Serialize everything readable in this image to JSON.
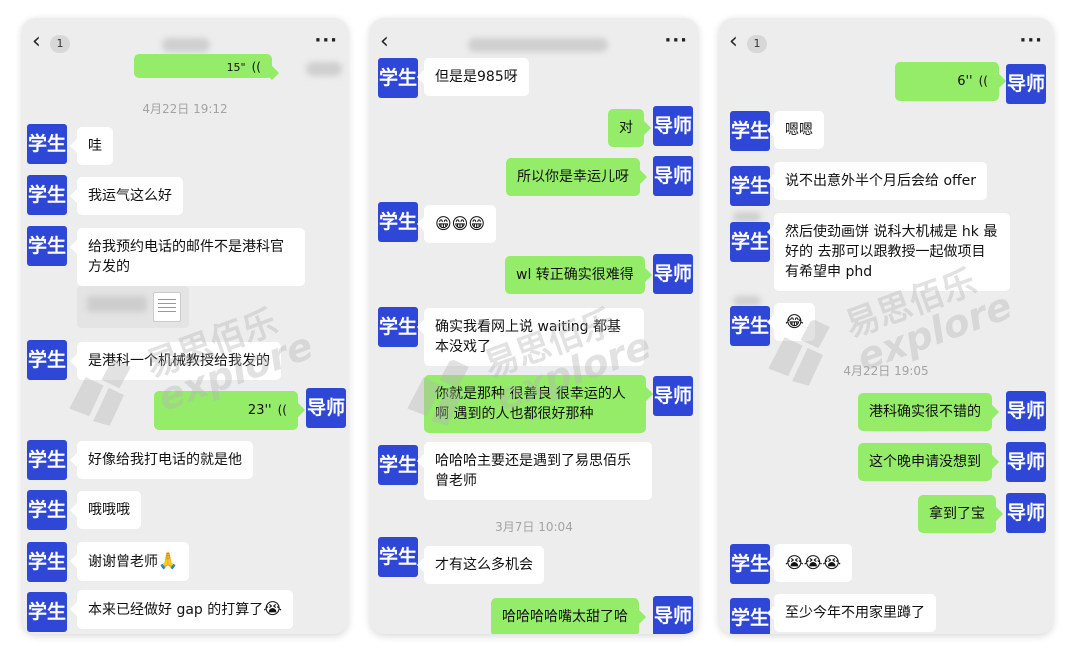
{
  "labels": {
    "student": "学生",
    "mentor": "导师"
  },
  "icons": {
    "back": "chevron-left-icon",
    "more": "more-dots-icon",
    "voice": "voice-wave-icon",
    "document": "document-icon"
  },
  "colors": {
    "avatar": "#2f47d6",
    "sent_bubble": "#95ec69",
    "received_bubble": "#ffffff",
    "background": "#ededed"
  },
  "watermark": {
    "cn": "易思佰乐",
    "en": "explore"
  },
  "panel1": {
    "unread": "1",
    "partial_voice_duration": "15\"",
    "timestamp": "4月22日 19:12",
    "msgs": [
      "哇",
      "我运气这么好",
      "给我预约电话的邮件不是港科官方发的",
      "是港科一个机械教授给我发的",
      "23''",
      "好像给我打电话的就是他",
      "哦哦哦",
      "谢谢曾老师",
      "本来已经做好 gap 的打算了"
    ],
    "emoji_pray": "🙏",
    "emoji_cry": "😭"
  },
  "panel2": {
    "msgs": [
      "但是是985呀",
      "对",
      "所以你是幸运儿呀",
      "😁😁😁",
      "wl 转正确实很难得",
      "确实我看网上说 waiting 都基本没戏了",
      "你就是那种 很善良 很幸运的人啊 遇到的人也都很好那种",
      "哈哈哈主要还是遇到了易思佰乐曾老师",
      "才有这么多机会",
      "哈哈哈哈嘴太甜了哈"
    ],
    "timestamp": "3月7日 10:04"
  },
  "panel3": {
    "unread": "1",
    "msgs": [
      "6''",
      "嗯嗯",
      "说不出意外半个月后会给 offer",
      "然后使劲画饼 说科大机械是 hk 最好的 去那可以跟教授一起做项目 有希望申 phd",
      "😂",
      "港科确实很不错的",
      "这个晚申请没想到",
      "拿到了宝",
      "😭😭😭",
      "至少今年不用家里蹲了"
    ],
    "timestamp": "4月22日 19:05"
  }
}
